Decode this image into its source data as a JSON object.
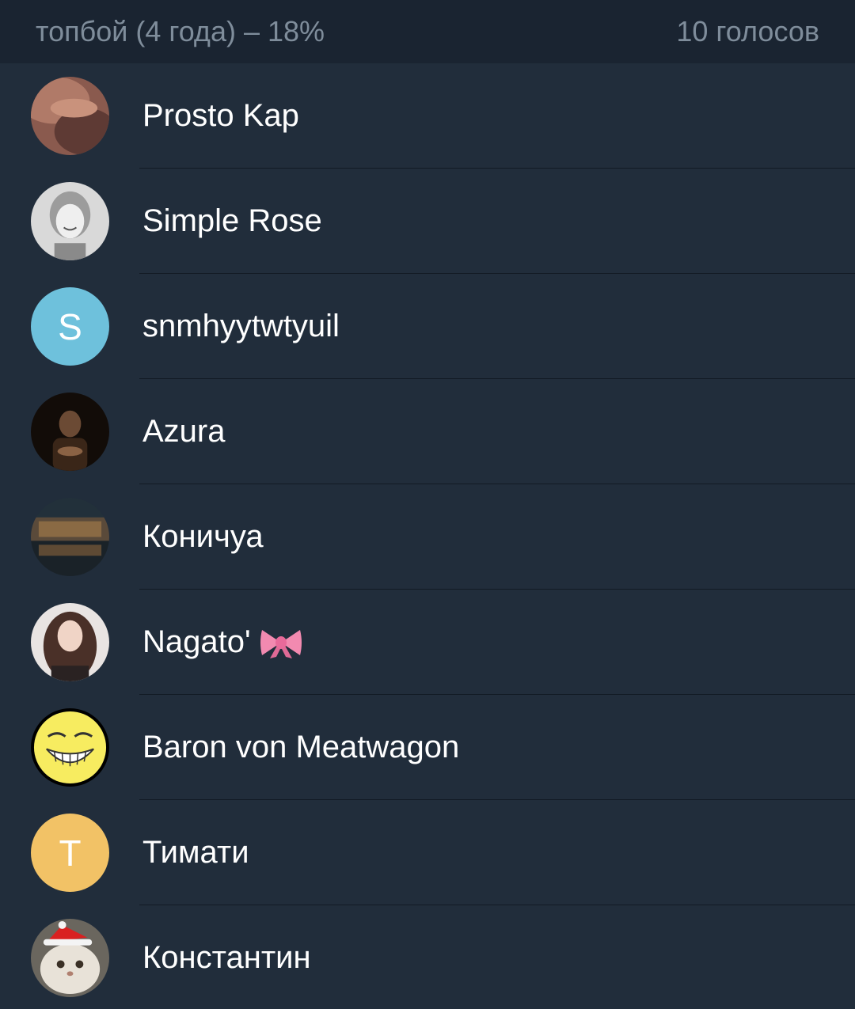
{
  "header": {
    "option_label": "топбой (4 года) – 18%",
    "votes_label": "10 голосов"
  },
  "voters": [
    {
      "name": "Prosto Kap",
      "avatar": "photo"
    },
    {
      "name": "Simple Rose",
      "avatar": "photo"
    },
    {
      "name": "snmhyytwtyuil",
      "avatar": "letter",
      "letter": "S",
      "color": "#6ec1dc"
    },
    {
      "name": "Azura",
      "avatar": "photo"
    },
    {
      "name": "Коничуа",
      "avatar": "photo"
    },
    {
      "name": "Nagato'",
      "avatar": "photo",
      "emoji": "ribbon-bow"
    },
    {
      "name": "Baron von Meatwagon",
      "avatar": "photo"
    },
    {
      "name": "Тимати",
      "avatar": "letter",
      "letter": "T",
      "color": "#f2c266"
    },
    {
      "name": "Константин",
      "avatar": "photo"
    }
  ],
  "colors": {
    "background": "#212d3b",
    "header_background": "#1a2431",
    "header_text": "#7f8d9b",
    "name_text": "#ffffff"
  }
}
